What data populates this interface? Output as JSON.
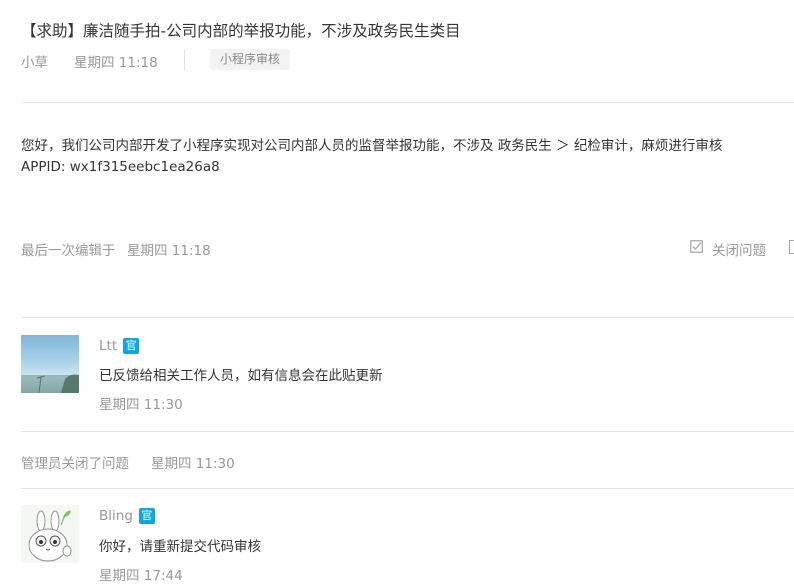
{
  "post": {
    "title": "【求助】廉洁随手拍-公司内部的举报功能，不涉及政务民生类目",
    "author": "小草",
    "time": "星期四 11:18",
    "tag": "小程序审核",
    "body_line1": "您好，我们公司内部开发了小程序实现对公司内部人员的监督举报功能，不涉及 政务民生 ＞ 纪检审计，麻烦进行审核",
    "body_line2": "APPID:   wx1f315eebc1ea26a8",
    "last_edit_label": "最后一次编辑于",
    "last_edit_time": "星期四 11:18",
    "close_label": "关闭问题"
  },
  "replies": [
    {
      "name": "Ltt",
      "badge": "官",
      "content": "已反馈给相关工作人员，如有信息会在此贴更新",
      "time": "星期四 11:30",
      "avatar_icon": "sky-photo-avatar"
    },
    {
      "name": "Bling",
      "badge": "官",
      "content": "你好，请重新提交代码审核",
      "time": "星期四 17:44",
      "avatar_icon": "bunny-avatar"
    }
  ],
  "system_event": {
    "label": "管理员关闭了问题",
    "time": "星期四 11:30"
  },
  "colors": {
    "badge": "#12a5de",
    "text": "#353535",
    "muted": "#9a9a9a",
    "divider": "#e6e6e6"
  }
}
